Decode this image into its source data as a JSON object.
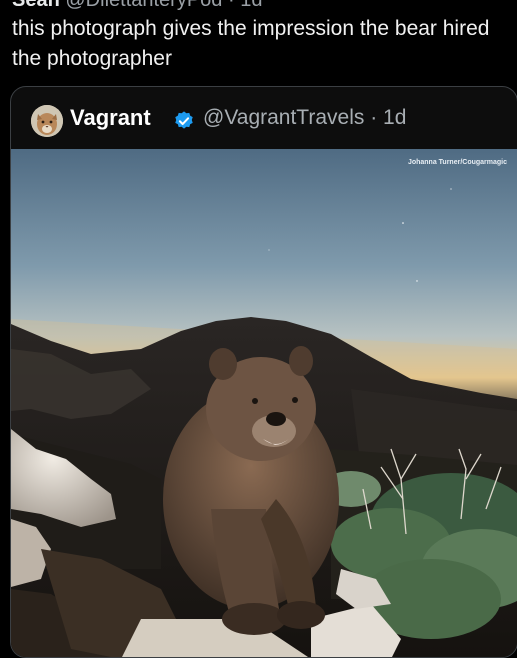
{
  "header": {
    "display_name_cut": "Sean",
    "handle_cut": "@DilettanteryPod · 1d"
  },
  "tweet": {
    "text": "this photograph gives the impression the bear hired the photographer"
  },
  "quote": {
    "name": "Vagrant",
    "handle_time": "@VagrantTravels · 1d",
    "photo_credit": "Johanna Turner/Cougarmagic",
    "colors": {
      "verified": "#1d9bf0",
      "sky_top": "#4f6b83",
      "sky_horizon": "#e9c98e",
      "bear": "#5a4536"
    },
    "icons": [
      "verified-badge-icon",
      "avatar-cougar-icon"
    ]
  }
}
